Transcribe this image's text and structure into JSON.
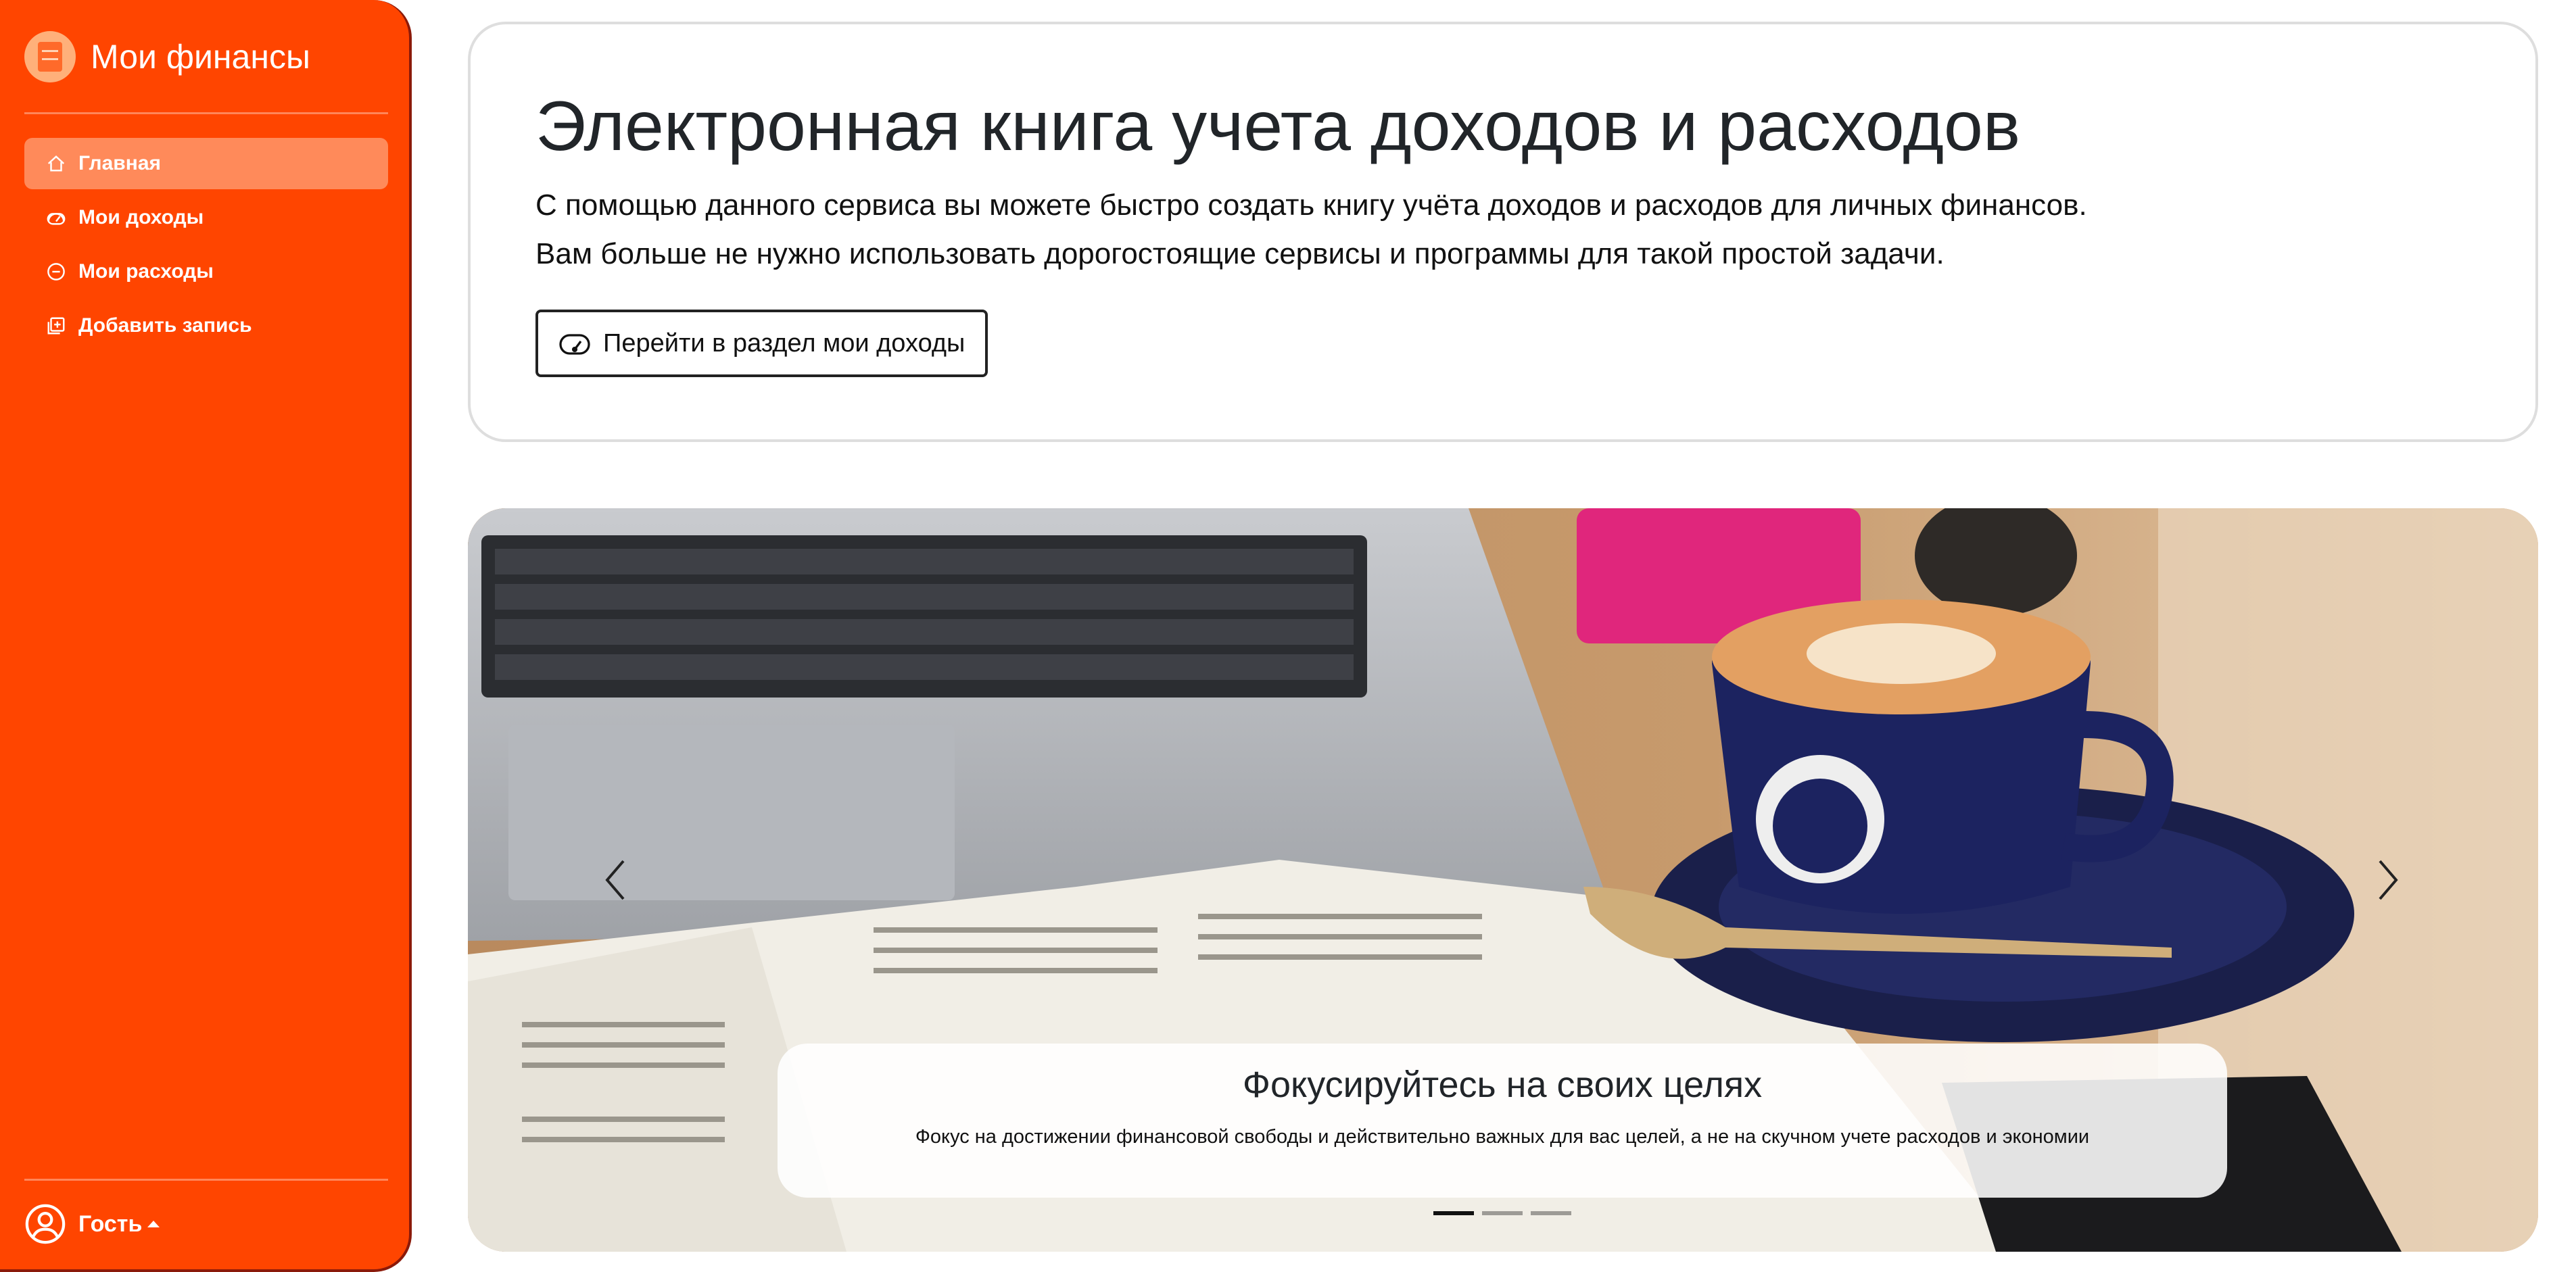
{
  "sidebar": {
    "brand": "Мои финансы",
    "items": [
      {
        "label": "Главная",
        "icon": "home-icon",
        "active": true
      },
      {
        "label": "Мои доходы",
        "icon": "speedometer-icon",
        "active": false
      },
      {
        "label": "Мои расходы",
        "icon": "dash-circle-icon",
        "active": false
      },
      {
        "label": "Добавить запись",
        "icon": "add-record-icon",
        "active": false
      }
    ],
    "user": {
      "label": "Гость",
      "icon": "person-circle-icon"
    }
  },
  "hero": {
    "title": "Электронная книга учета доходов и расходов",
    "line1": "С помощью данного сервиса вы можете быстро создать книгу учёта доходов и расходов для личных финансов.",
    "line2": "Вам больше не нужно использовать дорогостоящие сервисы и программы для такой простой задачи.",
    "button_label": "Перейти в раздел мои доходы",
    "button_icon": "speedometer-icon"
  },
  "carousel": {
    "caption_title": "Фокусируйтесь на своих целях",
    "caption_text": "Фокус на достижении финансовой свободы и действительно важных для вас целей, а не на скучном учете расходов и экономии",
    "slide_count": 3,
    "active_index": 0
  },
  "colors": {
    "sidebar_bg": "#ff4500",
    "sidebar_active": "#ff8a5a",
    "text": "#212529"
  }
}
